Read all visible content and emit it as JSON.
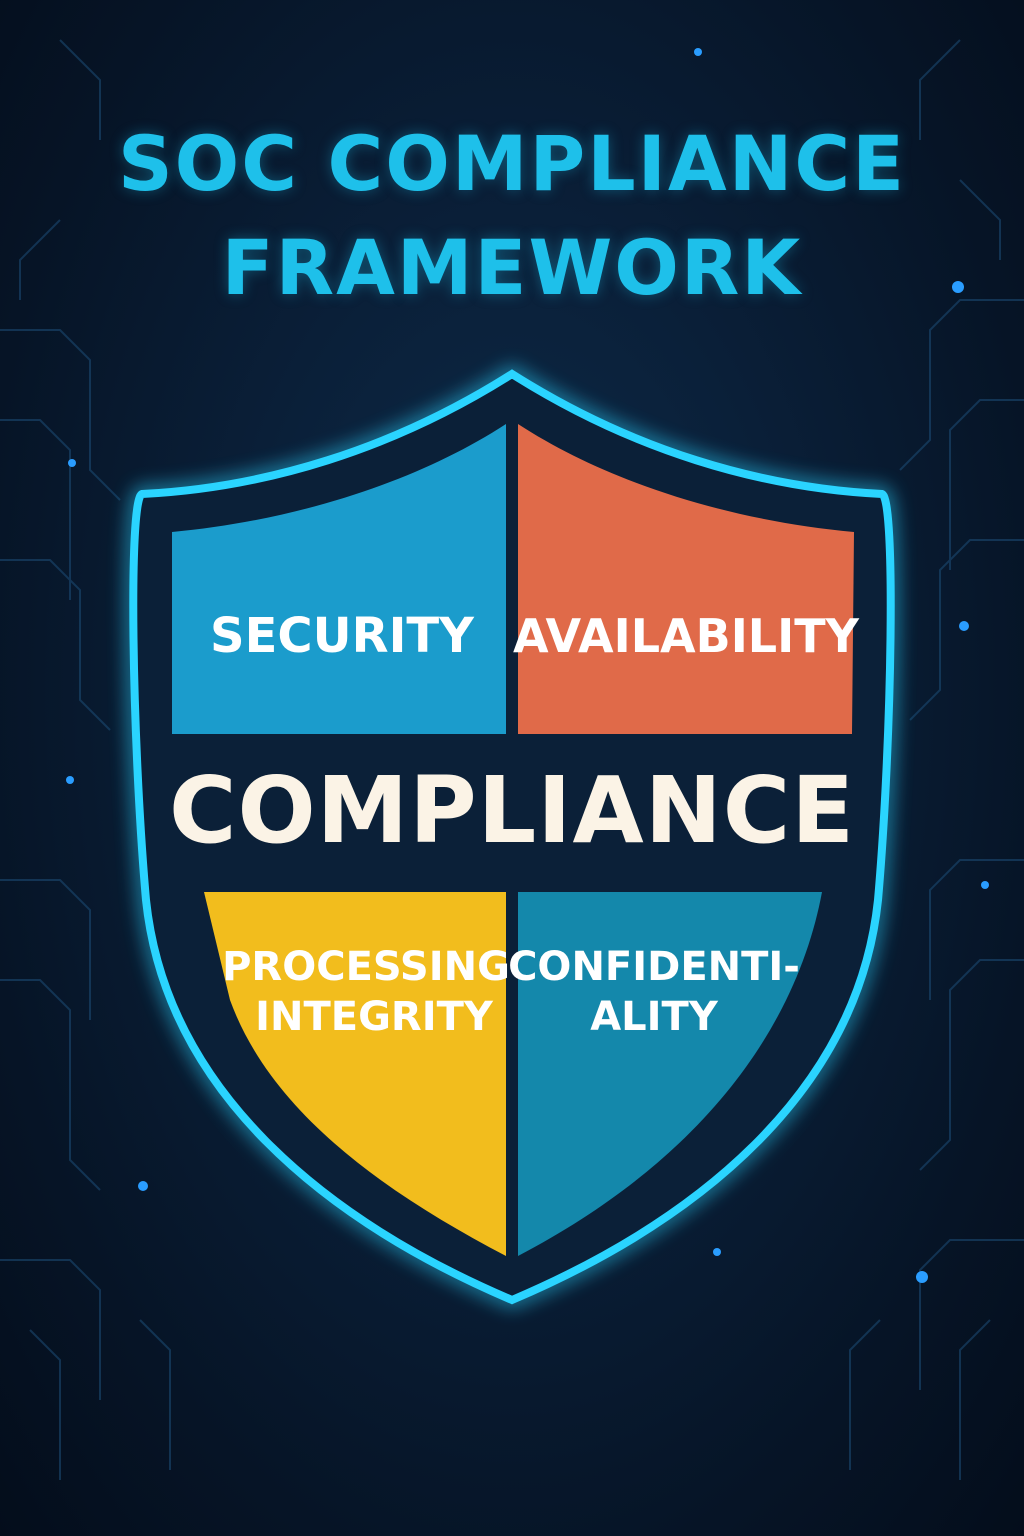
{
  "title": {
    "line1": "SOC COMPLIANCE",
    "line2": "FRAMEWORK"
  },
  "shield": {
    "center_label": "COMPLIANCE",
    "quadrants": [
      {
        "lines": [
          "SECURITY"
        ],
        "color": "#1b9ccc"
      },
      {
        "lines": [
          "AVAILABILITY"
        ],
        "color": "#e06a49"
      },
      {
        "lines": [
          "PROCESSING",
          "INTEGRITY"
        ],
        "color": "#f2bd1d"
      },
      {
        "lines": [
          "CONFIDENTI-",
          "ALITY"
        ],
        "color": "#1488ab"
      }
    ]
  },
  "colors": {
    "title": "#1ec0ea",
    "shield_outline": "#2ad4ff",
    "shield_fill": "#0b2038",
    "center_label": "#fbf3e6",
    "quadrant_text": "#ffffff"
  }
}
